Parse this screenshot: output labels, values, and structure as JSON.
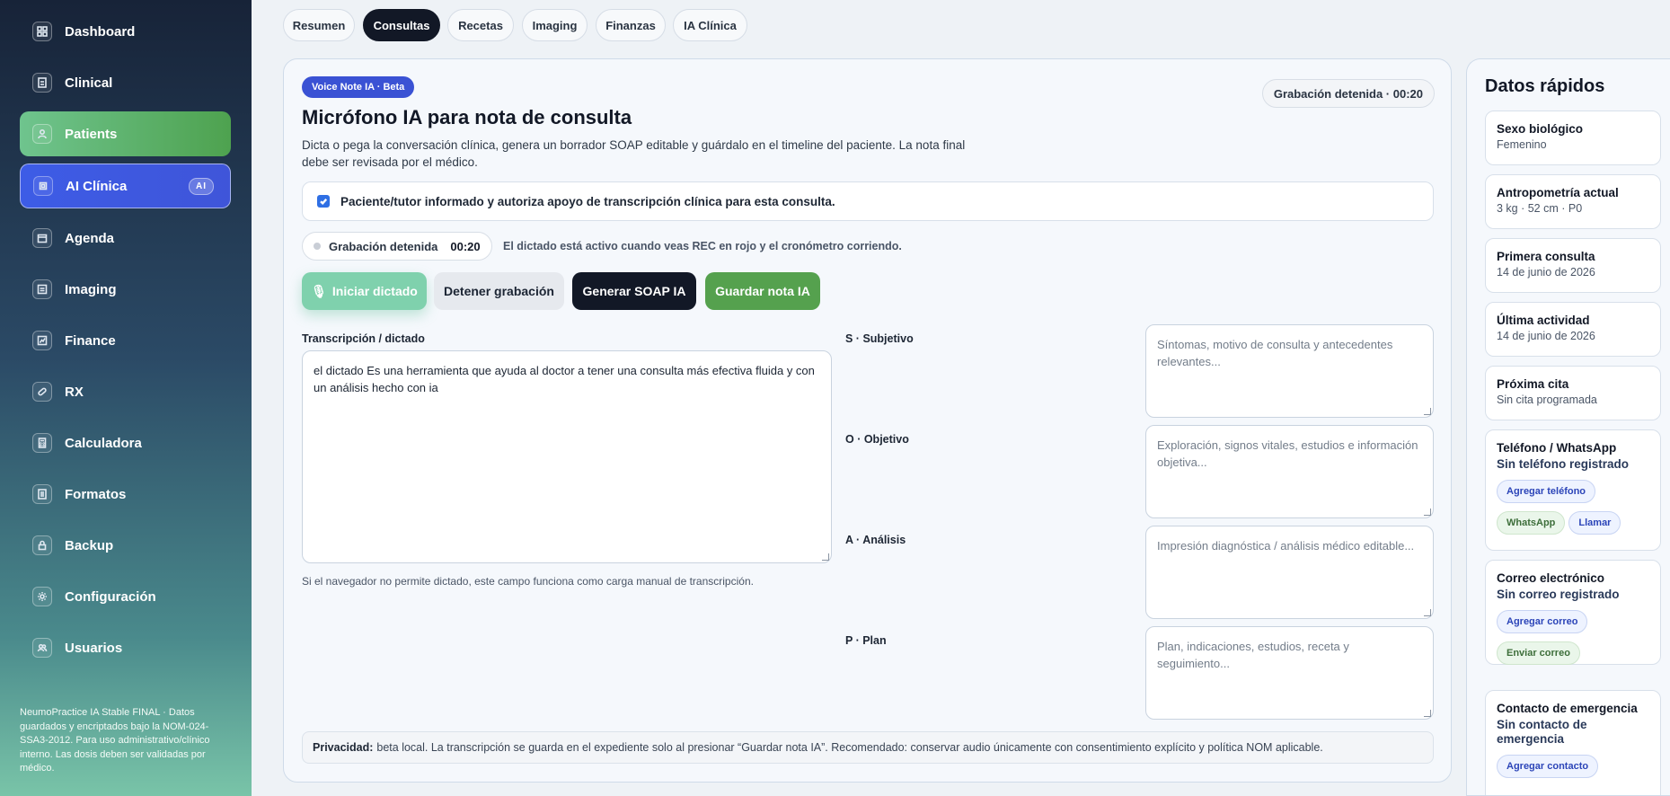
{
  "sidebar": {
    "items": [
      {
        "label": "Dashboard",
        "icon": "grid-icon"
      },
      {
        "label": "Clinical",
        "icon": "file-icon"
      },
      {
        "label": "Patients",
        "icon": "user-icon"
      },
      {
        "label": "AI Clínica",
        "icon": "chip-icon",
        "badge": "AI"
      },
      {
        "label": "Agenda",
        "icon": "calendar-icon"
      },
      {
        "label": "Imaging",
        "icon": "image-icon"
      },
      {
        "label": "Finance",
        "icon": "finance-icon"
      },
      {
        "label": "RX",
        "icon": "pill-icon"
      },
      {
        "label": "Calculadora",
        "icon": "calculator-icon"
      },
      {
        "label": "Formatos",
        "icon": "document-icon"
      },
      {
        "label": "Backup",
        "icon": "lock-icon"
      },
      {
        "label": "Configuración",
        "icon": "gear-icon"
      },
      {
        "label": "Usuarios",
        "icon": "users-icon"
      }
    ],
    "footer": "NeumoPractice IA Stable FINAL · Datos guardados y encriptados bajo la NOM-024-SSA3-2012. Para uso administrativo/clínico interno. Las dosis deben ser validadas por médico."
  },
  "tabs": [
    "Resumen",
    "Consultas",
    "Recetas",
    "Imaging",
    "Finanzas",
    "IA Clínica"
  ],
  "voice": {
    "badge": "Voice Note IA · Beta",
    "status_top": "Grabación detenida · 00:20",
    "title": "Micrófono IA para nota de consulta",
    "subtitle": "Dicta o pega la conversación clínica, genera un borrador SOAP editable y guárdalo en el timeline del paciente. La nota final debe ser revisada por el médico.",
    "consent": "Paciente/tutor informado y autoriza apoyo de transcripción clínica para esta consulta.",
    "rec_label": "Grabación detenida",
    "rec_time": "00:20",
    "rec_hint": "El dictado está activo cuando veas REC en rojo y el cronómetro corriendo.",
    "buttons": {
      "start": "Iniciar dictado",
      "stop": "Detener grabación",
      "soap": "Generar SOAP IA",
      "save": "Guardar nota IA"
    },
    "transcript_label": "Transcripción / dictado",
    "transcript_value": "el dictado Es una herramienta que ayuda al doctor a tener una consulta más efectiva fluida y con un análisis hecho con ia",
    "helper": "Si el navegador no permite dictado, este campo funciona como carga manual de transcripción.",
    "soap": [
      {
        "label": "S · Subjetivo",
        "placeholder": "Síntomas, motivo de consulta y antecedentes relevantes..."
      },
      {
        "label": "O · Objetivo",
        "placeholder": "Exploración, signos vitales, estudios e información objetiva..."
      },
      {
        "label": "A · Análisis",
        "placeholder": "Impresión diagnóstica / análisis médico editable..."
      },
      {
        "label": "P · Plan",
        "placeholder": "Plan, indicaciones, estudios, receta y seguimiento..."
      }
    ],
    "privacy_label": "Privacidad:",
    "privacy_text": "beta local. La transcripción se guarda en el expediente solo al presionar “Guardar nota IA”. Recomendado: conservar audio únicamente con consentimiento explícito y política NOM aplicable."
  },
  "quick": {
    "title": "Datos rápidos",
    "sex": {
      "k": "Sexo biológico",
      "v": "Femenino"
    },
    "anthro": {
      "k": "Antropometría actual",
      "v": "3 kg · 52 cm · P0"
    },
    "first": {
      "k": "Primera consulta",
      "v": "14 de junio de 2026"
    },
    "last": {
      "k": "Última actividad",
      "v": "14 de junio de 2026"
    },
    "next": {
      "k": "Próxima cita",
      "v": "Sin cita programada"
    },
    "phone": {
      "k": "Teléfono / WhatsApp",
      "v": "Sin teléfono registrado",
      "add": "Agregar teléfono",
      "wa": "WhatsApp",
      "call": "Llamar"
    },
    "email": {
      "k": "Correo electrónico",
      "v": "Sin correo registrado",
      "add": "Agregar correo",
      "send": "Enviar correo"
    },
    "emergency": {
      "k": "Contacto de emergencia",
      "v": "Sin contacto de emergencia",
      "add": "Agregar contacto"
    }
  }
}
